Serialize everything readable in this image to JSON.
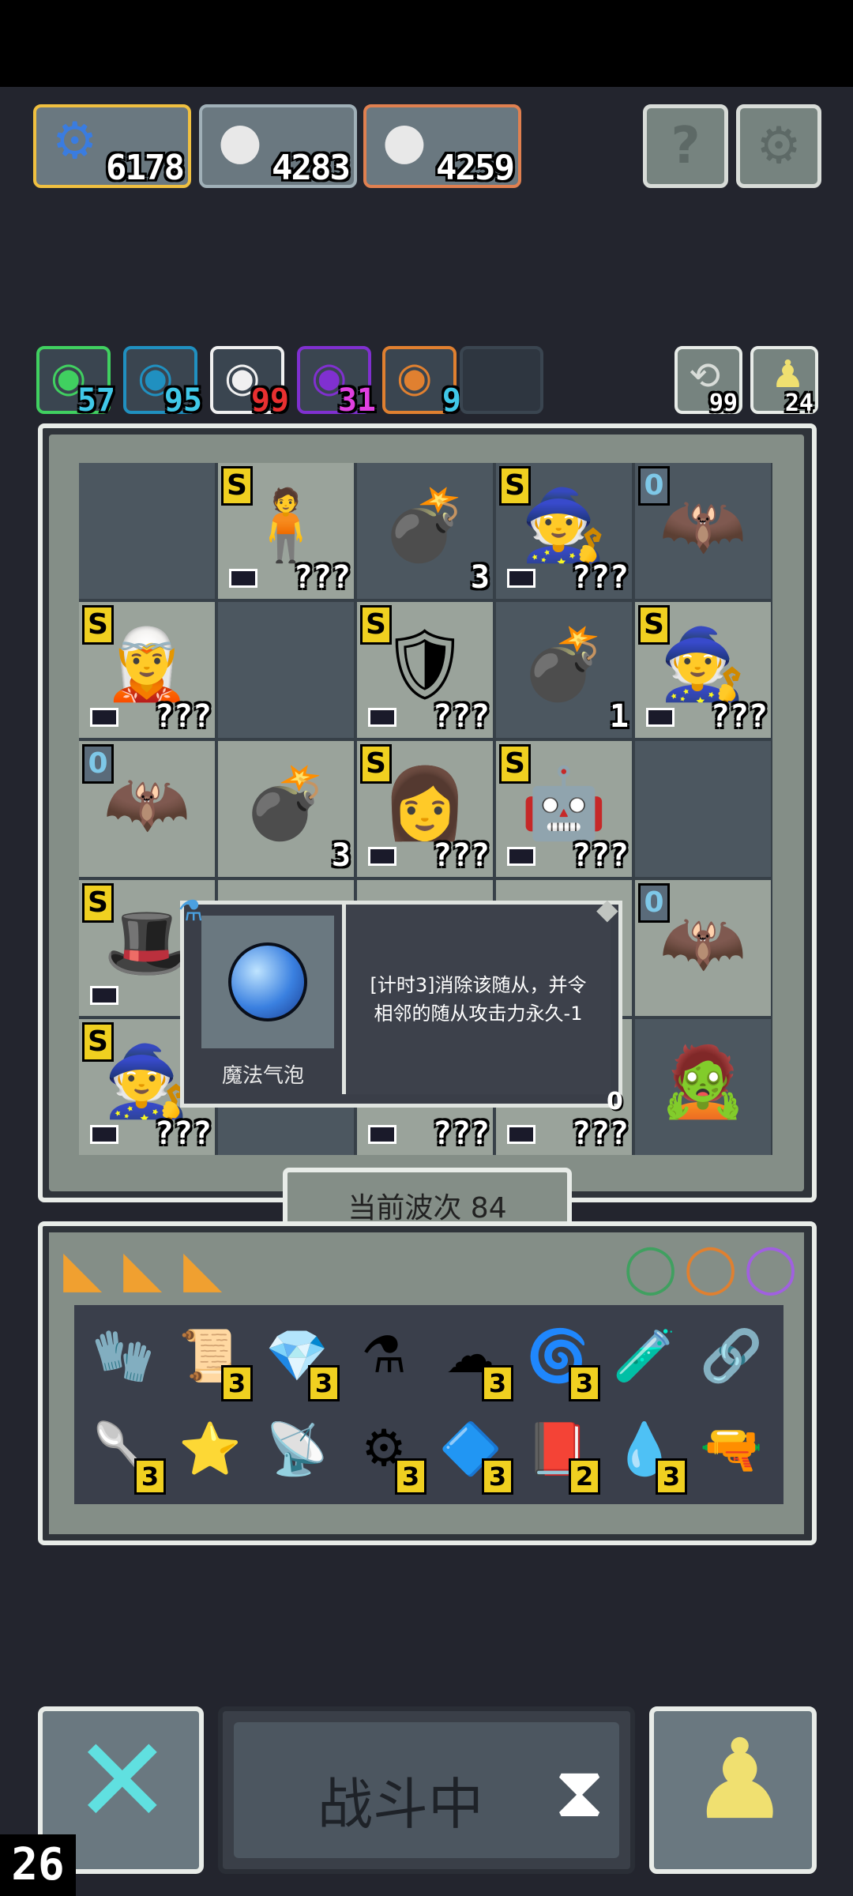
{
  "resources": [
    {
      "name": "gear-currency",
      "value": "6178",
      "border": "#f0c040"
    },
    {
      "name": "bomb-a",
      "value": "4283",
      "border": "#a0b0b8"
    },
    {
      "name": "bomb-b",
      "value": "4259",
      "border": "#e08050"
    }
  ],
  "top_buttons": {
    "help": "?",
    "settings": "⚙"
  },
  "stats": [
    {
      "value": "57",
      "color": "#40c8e8",
      "border": "#40d060"
    },
    {
      "value": "95",
      "color": "#40c8e8",
      "border": "#2090c0"
    },
    {
      "value": "99",
      "color": "#e83030",
      "border": "#f0f0f0"
    },
    {
      "value": "31",
      "color": "#e040e0",
      "border": "#8030d0"
    },
    {
      "value": "9",
      "color": "#40c8e8",
      "border": "#e08030"
    }
  ],
  "counters": [
    {
      "value": "99",
      "icon": "refresh-icon"
    },
    {
      "value": "24",
      "icon": "pawn-icon"
    }
  ],
  "grid": [
    {
      "tier": "",
      "icon": "",
      "label": "",
      "light": false
    },
    {
      "tier": "S",
      "icon": "🧍",
      "label": "???",
      "light": true
    },
    {
      "tier": "",
      "icon": "💣",
      "label": "3",
      "light": false
    },
    {
      "tier": "S",
      "icon": "🧙",
      "label": "???",
      "light": false
    },
    {
      "tier": "0",
      "icon": "🦇",
      "label": "",
      "light": false
    },
    {
      "tier": "S",
      "icon": "🧝",
      "label": "???",
      "light": true
    },
    {
      "tier": "",
      "icon": "",
      "label": "",
      "light": false
    },
    {
      "tier": "S",
      "icon": "🛡",
      "label": "???",
      "light": true
    },
    {
      "tier": "",
      "icon": "💣",
      "label": "1",
      "light": false
    },
    {
      "tier": "S",
      "icon": "🧙",
      "label": "???",
      "light": true
    },
    {
      "tier": "0",
      "icon": "🦇",
      "label": "",
      "light": true
    },
    {
      "tier": "",
      "icon": "💣",
      "label": "3",
      "light": true
    },
    {
      "tier": "S",
      "icon": "👩",
      "label": "???",
      "light": true
    },
    {
      "tier": "S",
      "icon": "🤖",
      "label": "???",
      "light": true
    },
    {
      "tier": "",
      "icon": "",
      "label": "",
      "light": false
    },
    {
      "tier": "S",
      "icon": "🎩",
      "label": "?",
      "light": true
    },
    {
      "tier": "",
      "icon": "",
      "label": "",
      "light": true
    },
    {
      "tier": "",
      "icon": "",
      "label": "",
      "light": true
    },
    {
      "tier": "",
      "icon": "",
      "label": "",
      "light": true
    },
    {
      "tier": "0",
      "icon": "🦇",
      "label": "",
      "light": true
    },
    {
      "tier": "S",
      "icon": "🧙",
      "label": "???",
      "light": true
    },
    {
      "tier": "",
      "icon": "",
      "label": "",
      "light": false
    },
    {
      "tier": "",
      "icon": "",
      "label": "???",
      "light": true
    },
    {
      "tier": "",
      "icon": "",
      "label": "???",
      "light": true
    },
    {
      "tier": "",
      "icon": "🧟",
      "label": "",
      "light": false
    }
  ],
  "tooltip": {
    "name": "魔法气泡",
    "desc": "[计时3]消除该随从，并令相邻的随从攻击力永久-1",
    "corner_value": "0"
  },
  "wave": {
    "label": "当前波次 84"
  },
  "inventory": {
    "cards": [
      "◣",
      "◣",
      "◣"
    ],
    "rings": [
      "◯",
      "◯",
      "◯"
    ],
    "row1": [
      {
        "icon": "🧤",
        "count": ""
      },
      {
        "icon": "📜",
        "count": "3"
      },
      {
        "icon": "💎",
        "count": "3"
      },
      {
        "icon": "⚗",
        "count": ""
      },
      {
        "icon": "☁",
        "count": "3"
      },
      {
        "icon": "🌀",
        "count": "3"
      },
      {
        "icon": "🧪",
        "count": ""
      },
      {
        "icon": "🔗",
        "count": ""
      }
    ],
    "row2": [
      {
        "icon": "🥄",
        "count": "3"
      },
      {
        "icon": "⭐",
        "count": ""
      },
      {
        "icon": "📡",
        "count": ""
      },
      {
        "icon": "⚙",
        "count": "3"
      },
      {
        "icon": "🔷",
        "count": "3"
      },
      {
        "icon": "📕",
        "count": "2"
      },
      {
        "icon": "💧",
        "count": "3"
      },
      {
        "icon": "🔫",
        "count": ""
      }
    ]
  },
  "bottom": {
    "close": "✕",
    "battle_label": "战斗中",
    "hourglass": "⧗",
    "pawn": "♟",
    "fps": "26"
  }
}
